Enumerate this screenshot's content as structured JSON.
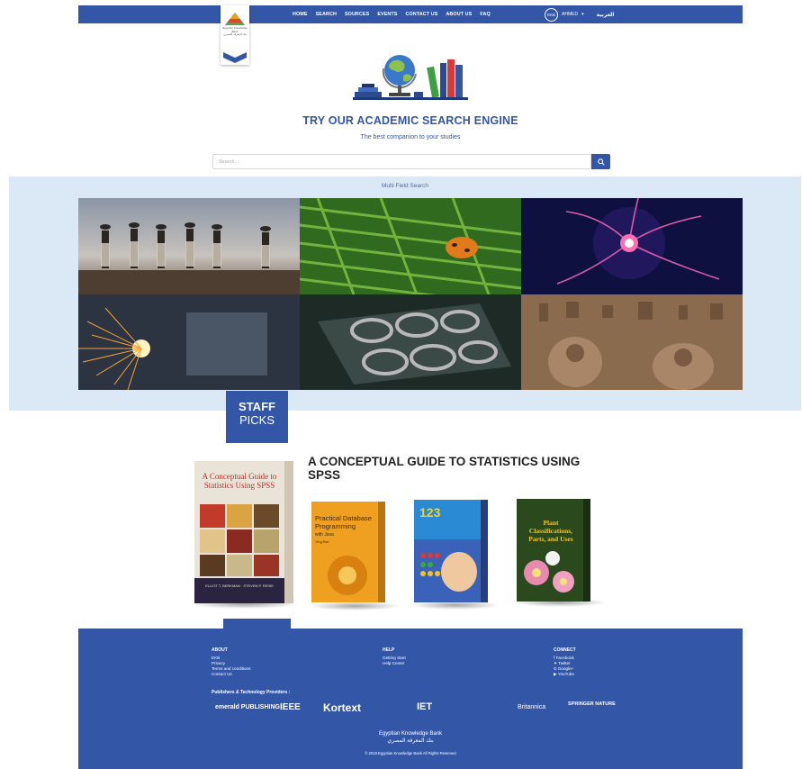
{
  "nav": {
    "links": [
      "HOME",
      "SEARCH",
      "SOURCES",
      "EVENTS",
      "CONTACT US",
      "ABOUT US",
      "FAQ"
    ],
    "avatar_initials": "EKB",
    "user_name": "AHMED",
    "user_caret": "▾",
    "language": "العربية"
  },
  "logo": {
    "text_en": "Egyptian Knowledge Bank",
    "text_ar": "بنك المعرفة المصري"
  },
  "hero": {
    "title": "TRY OUR ACADEMIC SEARCH ENGINE",
    "subtitle": "The best companion to your studies"
  },
  "search": {
    "placeholder": "Search..."
  },
  "multi_field_search": "Multi Field Search",
  "staff_picks": {
    "line1": "STAFF",
    "line2": "PICKS"
  },
  "featured_book": {
    "title": "A CONCEPTUAL GUIDE TO STATISTICS USING SPSS",
    "cover_title": "A Conceptual Guide to Statistics Using SPSS",
    "cover_authors": "ELLIOT T. BERKMAN · STEVEN P. REISE"
  },
  "books": [
    {
      "cover_title": "Practical Database Programming",
      "cover_sub": "with Java",
      "author": "Ying Bai"
    },
    {
      "cover_title": "123"
    },
    {
      "cover_title": "Plant Classifications, Parts, and Uses"
    }
  ],
  "footer": {
    "about": {
      "heading": "ABOUT",
      "items": [
        "EKB",
        "Privacy",
        "Terms and conditions",
        "Contact Us"
      ]
    },
    "help": {
      "heading": "HELP",
      "items": [
        "Getting Start",
        "Help Center"
      ]
    },
    "connect": {
      "heading": "CONNECT",
      "items": [
        "Facebook",
        "Twitter",
        "Google+",
        "YouTube"
      ]
    },
    "providers_label": "Publishers & Technology Providers :",
    "providers": [
      "emerald PUBLISHING",
      "IEEE",
      "Kortext",
      "IET",
      "Britannica",
      "SPRINGER NATURE"
    ],
    "org_en": "Egyptian Knowledge Bank",
    "org_ar": "بنك المعرفة المصري",
    "copyright": "© 2019 Egyptian Knowledge Bank All Rights Reserved"
  },
  "colors": {
    "primary": "#3456a6",
    "band": "#dbe8f5"
  }
}
